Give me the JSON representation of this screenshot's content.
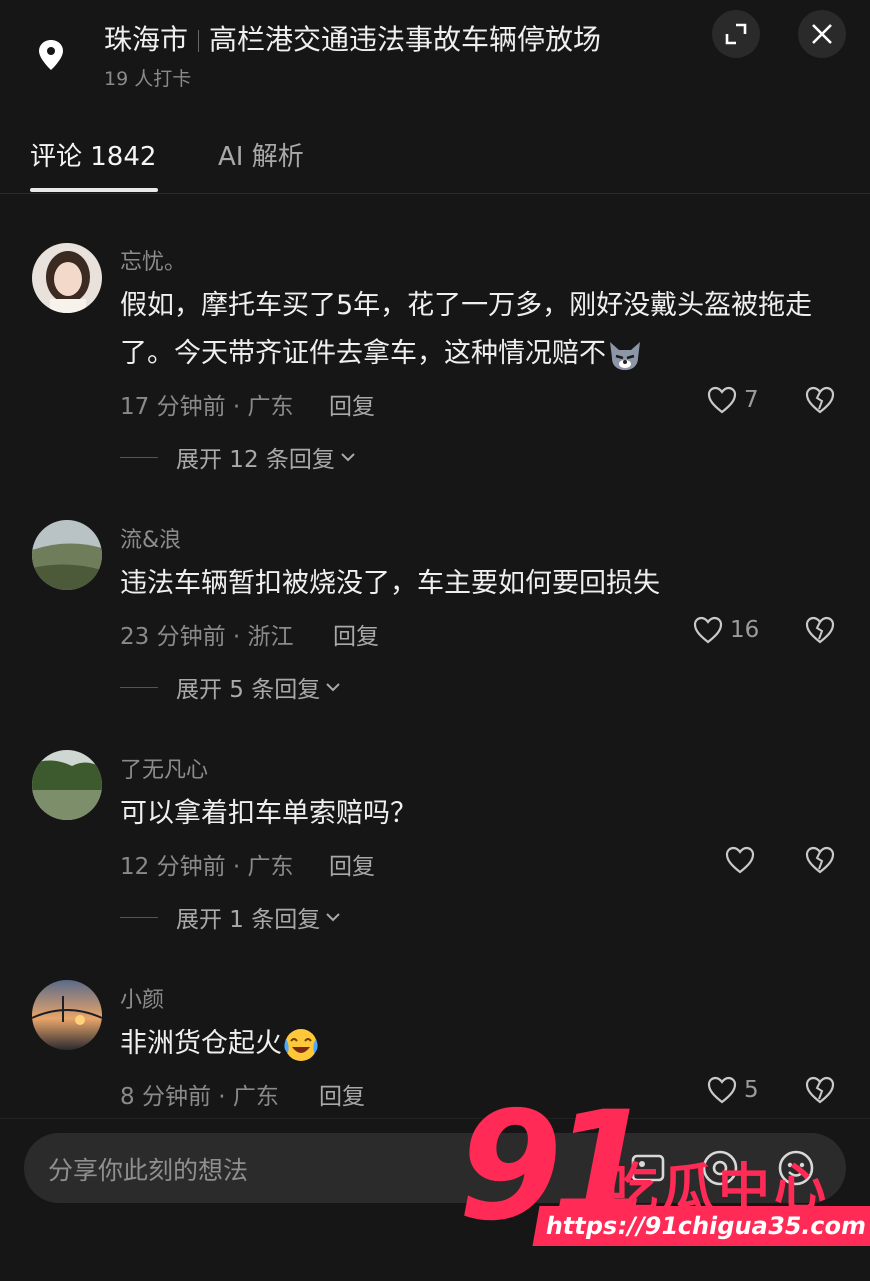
{
  "header": {
    "city": "珠海市",
    "place": "高栏港交通违法事故车辆停放场",
    "checkins": "19 人打卡"
  },
  "tabs": [
    {
      "label": "评论 1842"
    },
    {
      "label": "AI 解析"
    }
  ],
  "comments": [
    {
      "user": "忘忧。",
      "text": "假如，摩托车买了5年，花了一万多，刚好没戴头盔被拖走了。今天带齐证件去拿车，这种情况赔不",
      "emoji": "wolf-emoji",
      "meta": "17 分钟前 · 广东",
      "reply_label": "回复",
      "likes": "7",
      "expand": "展开 12 条回复"
    },
    {
      "user": "流&浪",
      "text": "违法车辆暂扣被烧没了，车主要如何要回损失",
      "meta": "23 分钟前 · 浙江",
      "reply_label": "回复",
      "likes": "16",
      "expand": "展开 5 条回复"
    },
    {
      "user": "了无凡心",
      "text": "可以拿着扣车单索赔吗？",
      "meta": "12 分钟前 · 广东",
      "reply_label": "回复",
      "likes": "",
      "expand": "展开 1 条回复"
    },
    {
      "user": "小颜",
      "text": "非洲货仓起火",
      "emoji": "crying-laughing-emoji",
      "meta": "8 分钟前 · 广东",
      "reply_label": "回复",
      "likes": "5"
    }
  ],
  "input": {
    "placeholder": "分享你此刻的想法"
  },
  "watermark": {
    "number": "91",
    "brand": "吃瓜中心",
    "url": "https://91chigua35.com"
  },
  "colors": {
    "background": "#161616",
    "accent": "#ff2a55"
  }
}
